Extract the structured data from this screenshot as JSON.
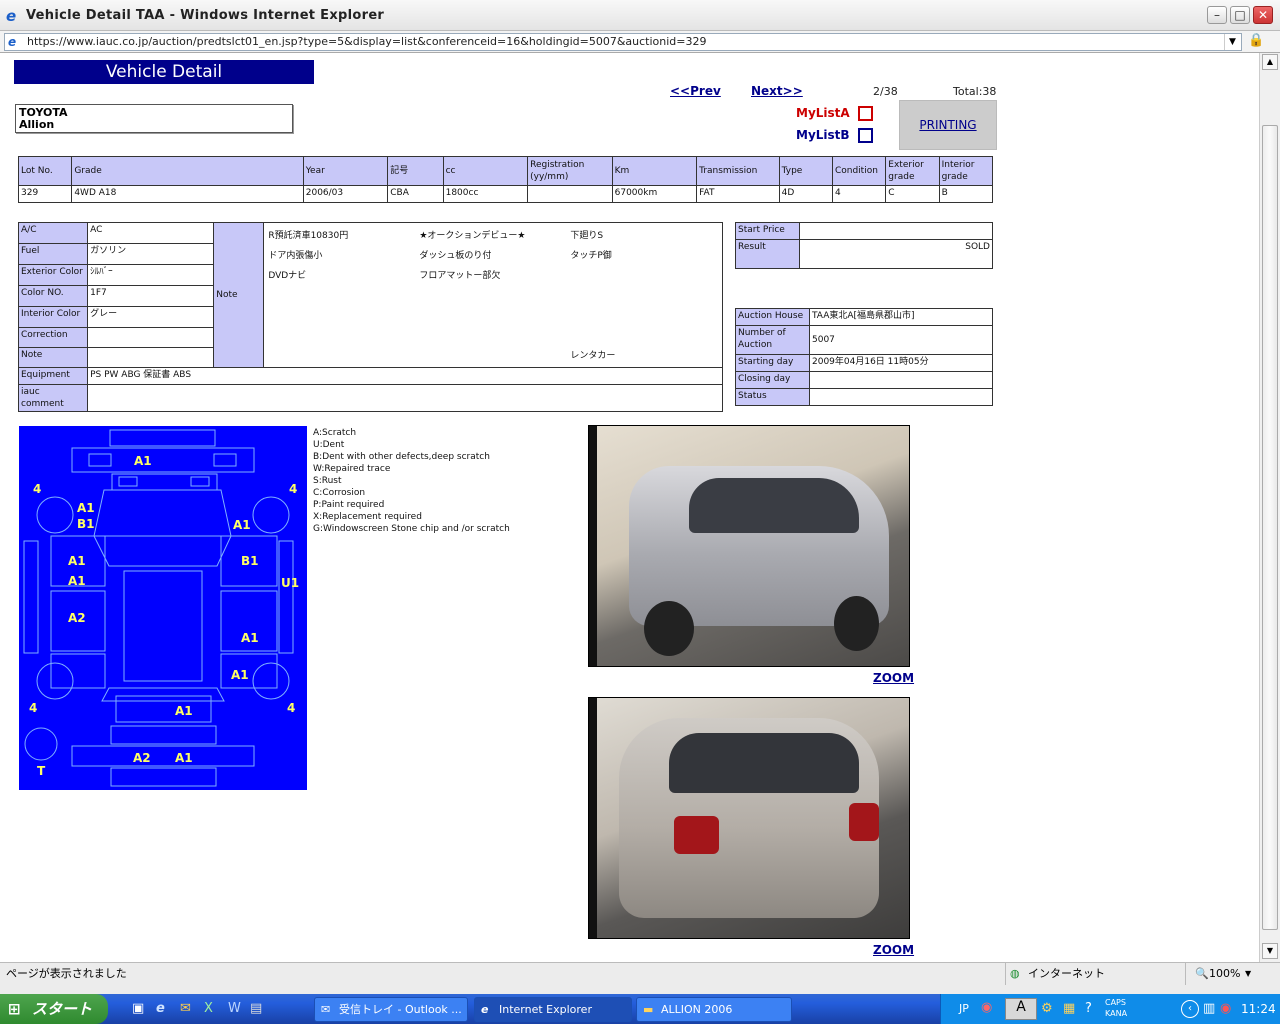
{
  "window": {
    "title": "Vehicle Detail TAA - Windows Internet Explorer",
    "url": "https://www.iauc.co.jp/auction/predtslct01_en.jsp?type=5&display=list&conferenceid=16&holdingid=5007&auctionid=329"
  },
  "page": {
    "heading": "Vehicle Detail",
    "maker": "TOYOTA",
    "model": "Allion",
    "prev": "<<Prev",
    "next": "Next>>",
    "position": "2/38",
    "total": "Total:38",
    "mylist_a": "MyListA",
    "mylist_b": "MyListB",
    "printing": "PRINTING",
    "spec_headers": [
      "Lot No.",
      "Grade",
      "Year",
      "記号",
      "cc",
      "Registration (yy/mm)",
      "Km",
      "Transmission",
      "Type",
      "Condition",
      "Exterior grade",
      "Interior grade"
    ],
    "spec_values": [
      "329",
      "4WD A18",
      "2006/03",
      "CBA",
      "1800cc",
      "",
      "67000km",
      "FAT",
      "4D",
      "4",
      "C",
      "B"
    ],
    "details": {
      "ac_label": "A/C",
      "ac": "AC",
      "fuel_label": "Fuel",
      "fuel": "ガソリン",
      "ext_label": "Exterior Color",
      "ext": "ｼﾙﾊﾞｰ",
      "colorno_label": "Color NO.",
      "colorno": "1F7",
      "int_label": "Interior Color",
      "int": "グレー",
      "correction_label": "Correction",
      "correction": "",
      "note_label": "Note",
      "note": "",
      "equipment_label": "Equipment",
      "equipment": "PS PW ABG 保証書 ABS",
      "iauc_label": "iauc comment",
      "iauc": "",
      "note_header": "Note",
      "notes": [
        "R預託済車10830円",
        "★オークションデビュー★",
        "下廻りS",
        "ドア内張傷小",
        "ダッシュ板のり付",
        "タッチP御",
        "DVDナビ",
        "フロアマットー部欠",
        "レンタカー"
      ]
    },
    "price": {
      "start_label": "Start Price",
      "start": "",
      "result_label": "Result",
      "result": "SOLD"
    },
    "auction": {
      "house_label": "Auction House",
      "house": "TAA東北A[福島県郡山市]",
      "number_label": "Number of Auction",
      "number": "5007",
      "start_label": "Starting day",
      "start": "2009年04月16日 11時05分",
      "closing_label": "Closing day",
      "closing": "",
      "status_label": "Status",
      "status": ""
    },
    "legend": [
      "A:Scratch",
      "U:Dent",
      "B:Dent with other defects,deep scratch",
      "W:Repaired trace",
      "S:Rust",
      "C:Corrosion",
      "P:Paint required",
      "X:Replacement required",
      "G:Windowscreen Stone chip and /or scratch"
    ],
    "diagram_marks": [
      "A1",
      "4",
      "4",
      "A1",
      "B1",
      "A1",
      "A1",
      "B1",
      "A1",
      "U1",
      "A2",
      "A1",
      "A1",
      "4",
      "A1",
      "4",
      "A2",
      "A1",
      "T"
    ],
    "zoom": "ZOOM"
  },
  "status": {
    "text": "ページが表示されました",
    "zone": "インターネット",
    "zoom": "100%"
  },
  "taskbar": {
    "start": "スタート",
    "tasks": [
      "受信トレイ - Outlook ...",
      "Internet Explorer",
      "ALLION 2006"
    ],
    "lang": "JP",
    "time": "11:24",
    "caps": "CAPS",
    "kana": "KANA"
  }
}
